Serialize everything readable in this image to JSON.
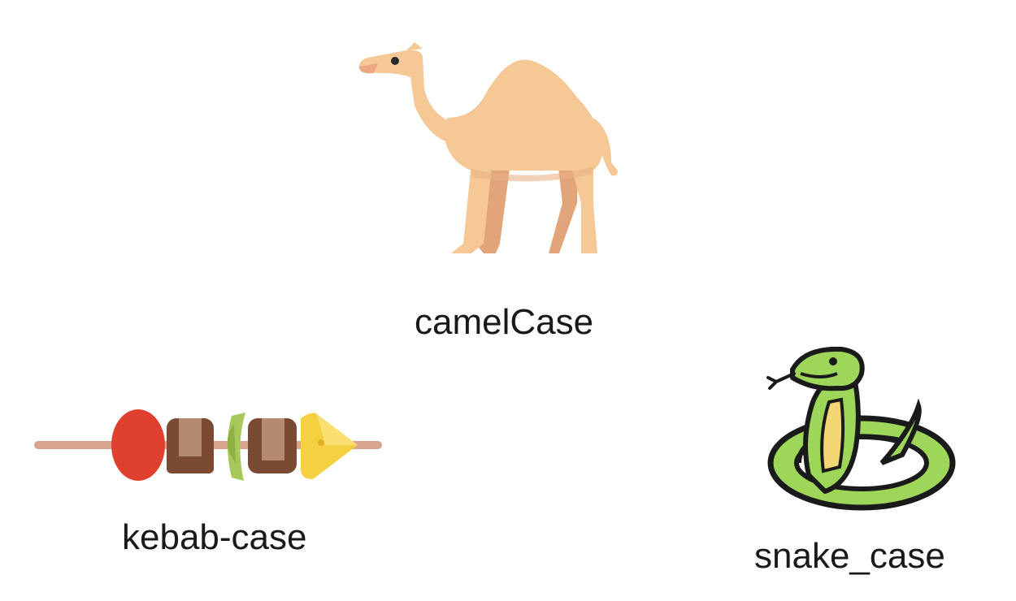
{
  "items": [
    {
      "label": "camelCase",
      "icon": "camel-icon"
    },
    {
      "label": "kebab-case",
      "icon": "kebab-skewer-icon"
    },
    {
      "label": "snake_case",
      "icon": "snake-icon"
    }
  ],
  "colors": {
    "camel_body": "#F5C896",
    "camel_shade": "#E2A57A",
    "kebab_stick": "#D9A58F",
    "kebab_tomato": "#E0412E",
    "kebab_meat_light": "#B48A70",
    "kebab_meat_dark": "#7A4A32",
    "kebab_pepper": "#A6C75A",
    "kebab_cheese": "#F5D040",
    "snake_green": "#9ED65A",
    "snake_yellow": "#F4D774",
    "snake_outline": "#1A1A1A"
  }
}
